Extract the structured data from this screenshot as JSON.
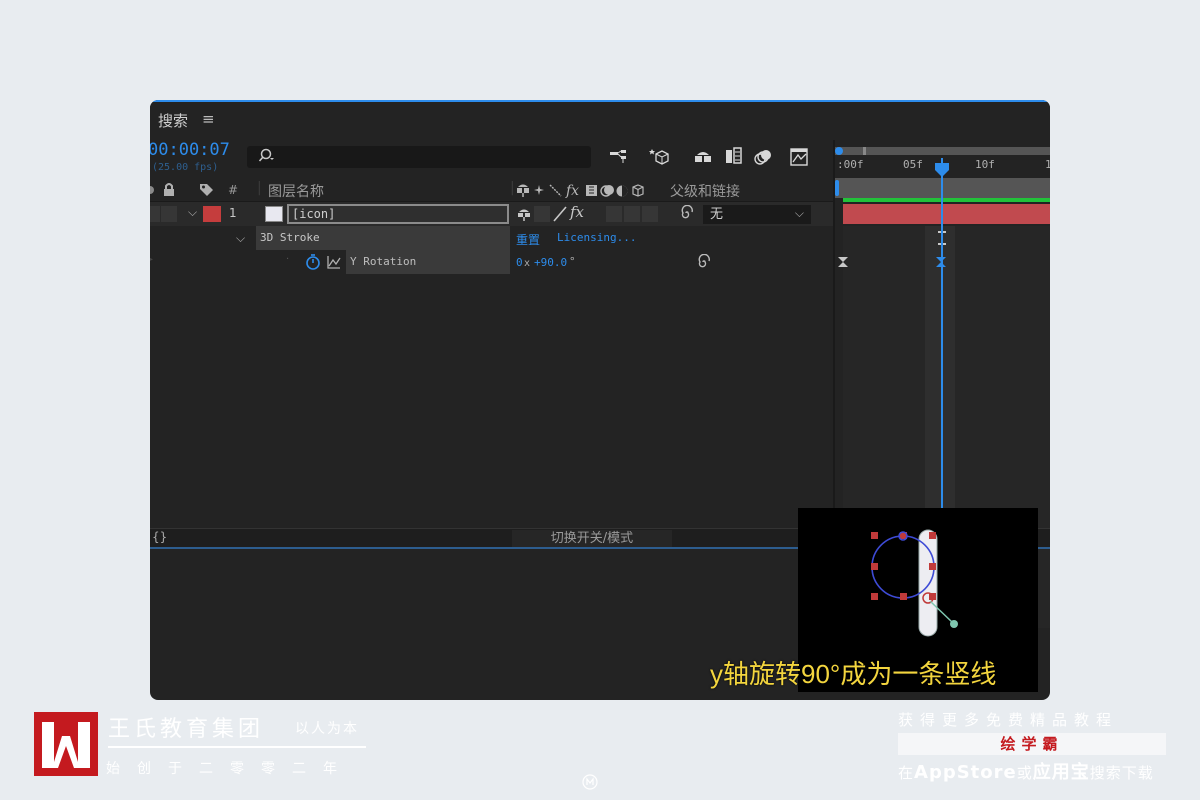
{
  "panel": {
    "title": "搜索",
    "menu_glyph": "≡"
  },
  "timecode": {
    "value": "00:00:07",
    "fps": "(25.00 fps)"
  },
  "search": {
    "icon": "search-icon",
    "placeholder": ""
  },
  "columns": {
    "num": "#",
    "layer_name": "图层名称",
    "parent": "父级和链接"
  },
  "layer1": {
    "number": "1",
    "name": "[icon]",
    "parent_value": "无",
    "color": "#c53d3d"
  },
  "effect_row": {
    "name": "3D Stroke",
    "reset": "重置",
    "licensing": "Licensing..."
  },
  "property_row": {
    "name": "Y Rotation",
    "value_prefix": "0",
    "value_x": "x",
    "value_rest": "+90.0",
    "value_deg": "°"
  },
  "ruler": {
    "labels": [
      ":00f",
      "05f",
      "10f",
      "1"
    ]
  },
  "bottom": {
    "mode_label": "切换开关/模式",
    "brace": "{}"
  },
  "caption": "y轴旋转90°成为一条竖线",
  "brand": {
    "name": "王氏教育集团",
    "slogan": "以人为本",
    "founded": "始创于二零零二年"
  },
  "promo": {
    "top": "获得更多免费精品教程",
    "app_name": "绘学霸",
    "bottom_pre": "在",
    "bottom_store": "AppStore",
    "bottom_or": "或",
    "bottom_market": "应用宝",
    "bottom_post": "搜索下载"
  },
  "colors": {
    "accent_blue": "#2d8ceb",
    "layer_red": "#c53d3d",
    "caption_yellow": "#f3d53e",
    "brand_red": "#c41a1f",
    "timeline_green": "#22c23a"
  }
}
